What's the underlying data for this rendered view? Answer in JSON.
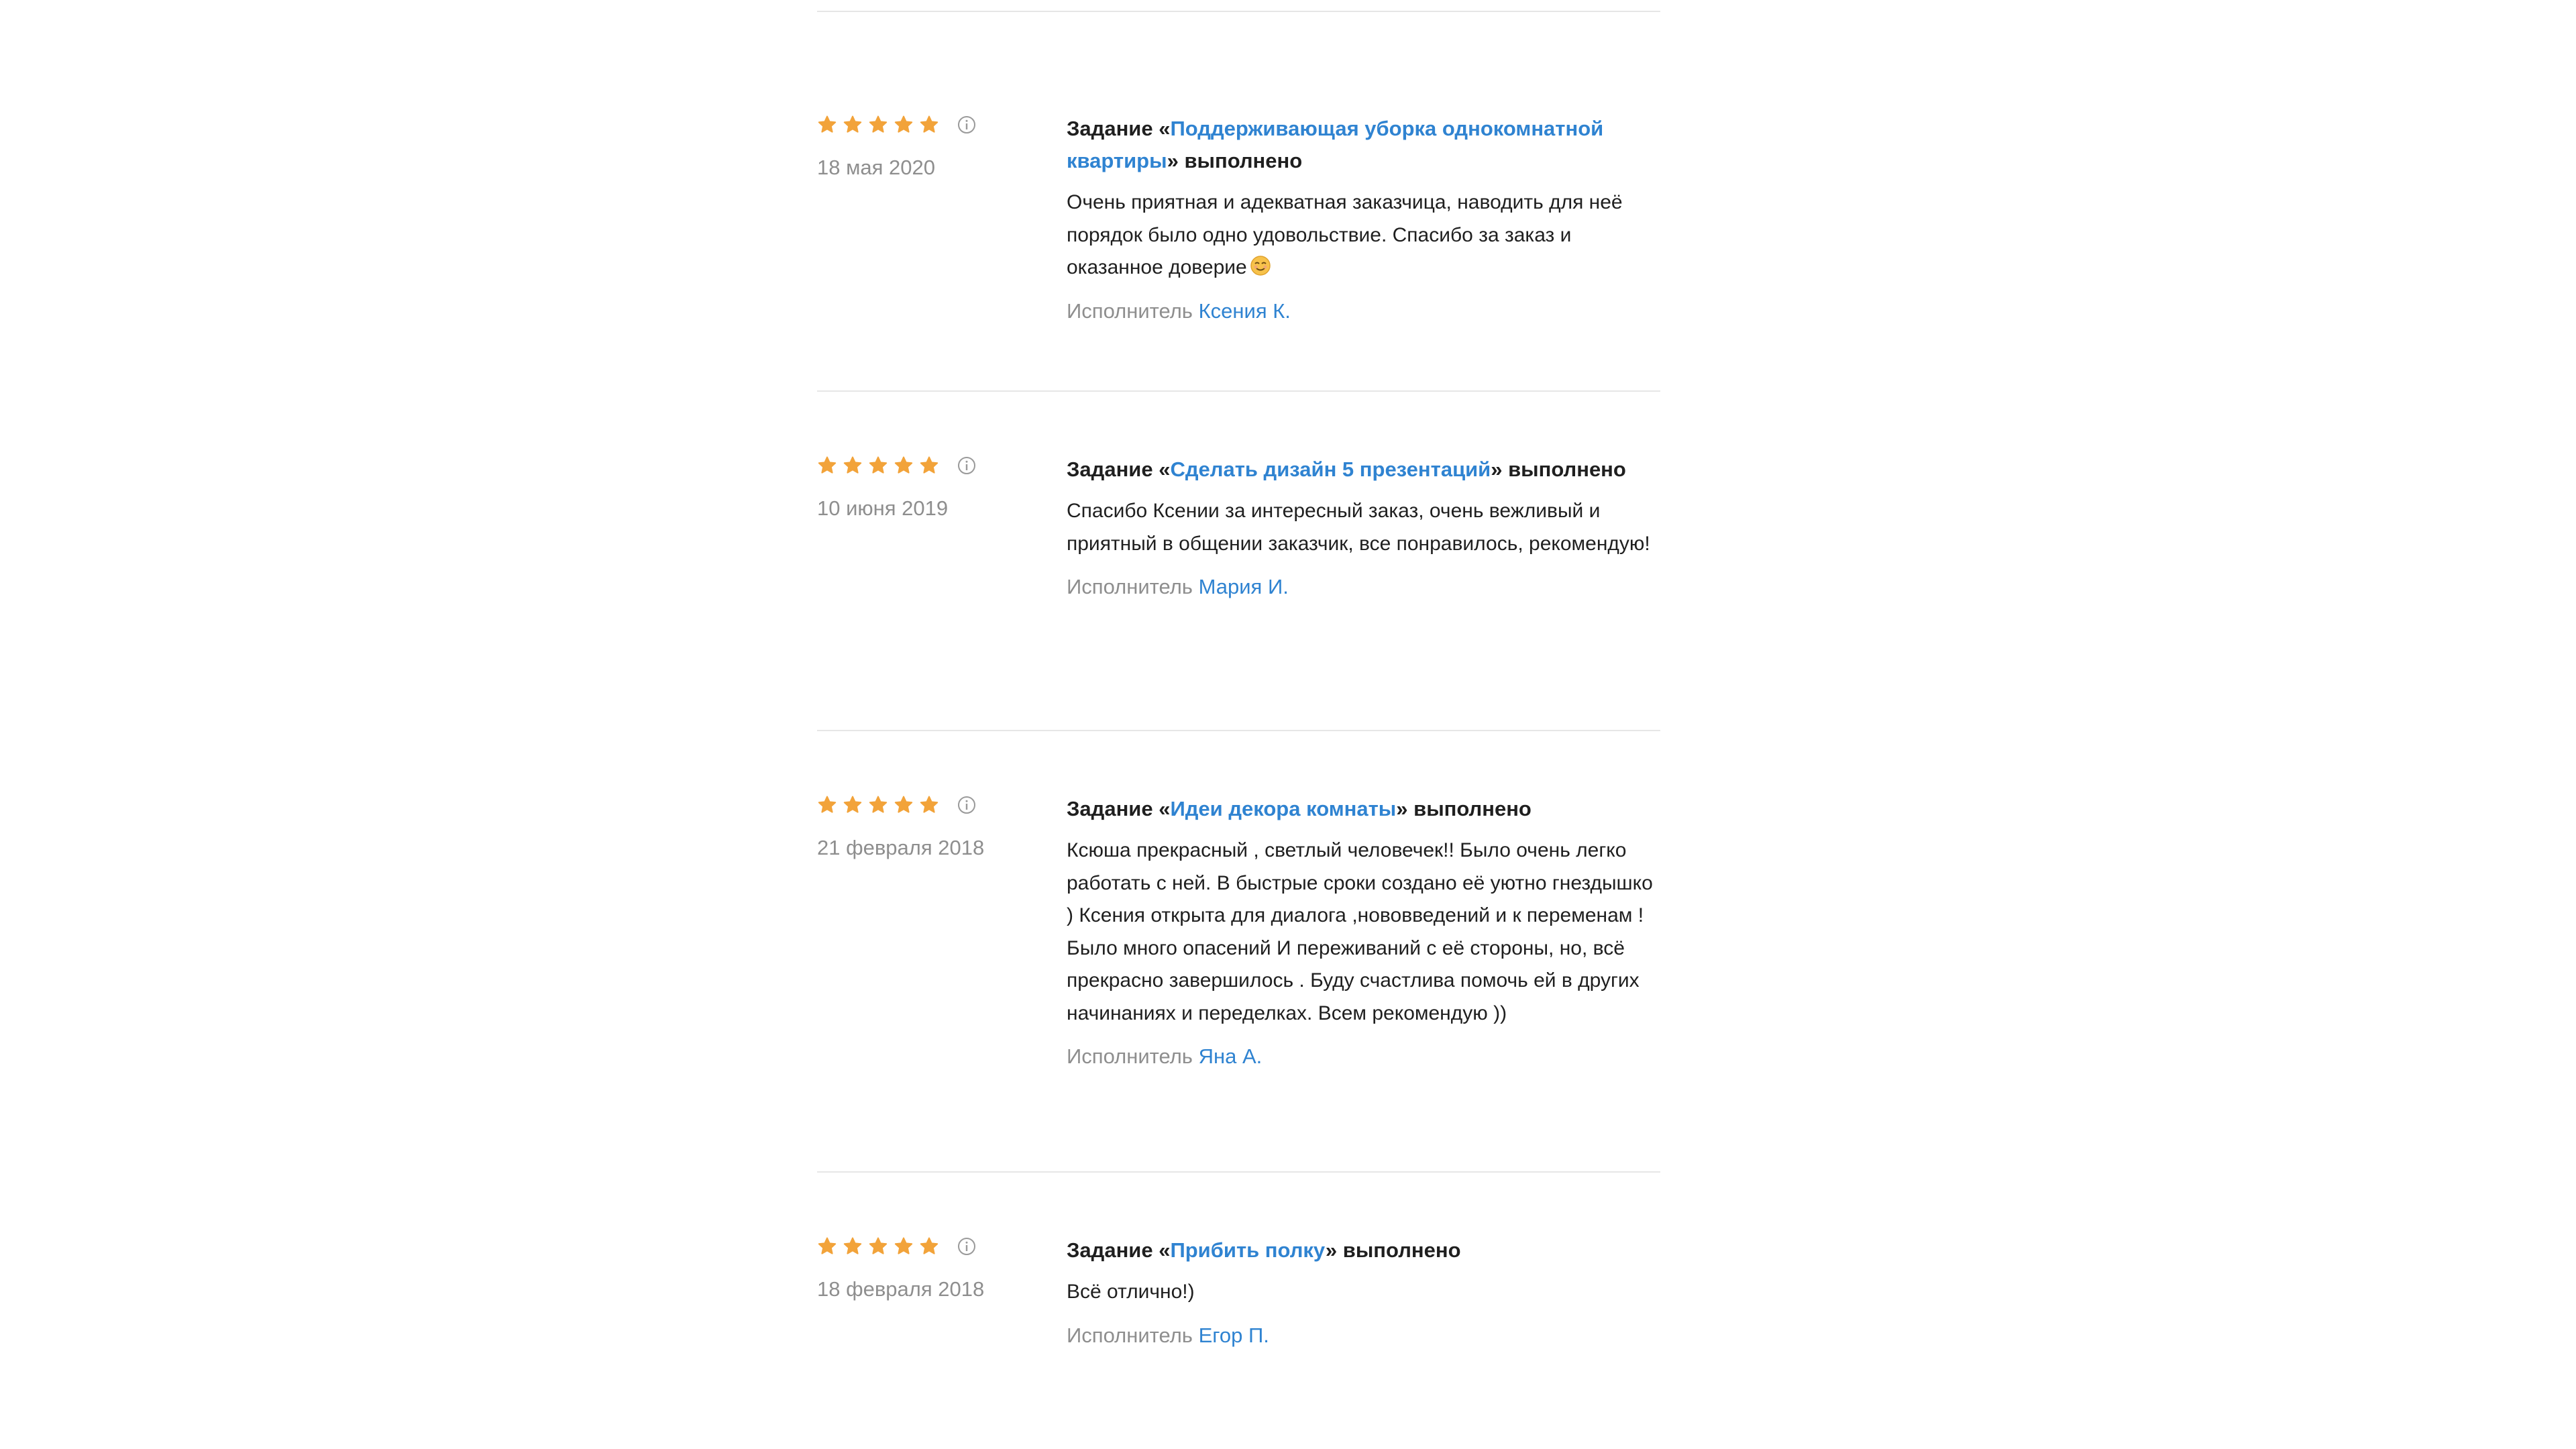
{
  "colors": {
    "star": "#f2a33a",
    "link": "#2f83d1",
    "muted": "#8e8e8e",
    "text": "#1f1f1f",
    "divider": "#e6e6e6"
  },
  "labels": {
    "task_prefix": "Задание «",
    "task_suffix": "» выполнено",
    "performer_prefix": "Исполнитель "
  },
  "reviews": [
    {
      "rating": 5,
      "date": "18 мая 2020",
      "task": "Поддерживающая уборка однокомнатной квартиры",
      "text": "Очень приятная и адекватная заказчица, наводить для неё порядок было одно удовольствие. Спасибо за заказ и оказанное доверие",
      "emoji": "smiling-face-emoji",
      "performer": "Ксения К."
    },
    {
      "rating": 5,
      "date": "10 июня 2019",
      "task": "Сделать дизайн 5 презентаций",
      "text": "Спасибо Ксении за интересный заказ, очень вежливый и приятный в общении заказчик, все понравилось, рекомендую!",
      "performer": "Мария И."
    },
    {
      "rating": 5,
      "date": "21 февраля 2018",
      "task": "Идеи декора комнаты",
      "text": "Ксюша прекрасный , светлый человечек!! Было очень легко работать с ней. В быстрые сроки создано её уютно гнездышко ) Ксения открыта для диалога ,нововведений и к переменам ! Было много опасений И переживаний с её стороны, но, всё прекрасно завершилось . Буду счастлива помочь ей в других начинаниях и переделках. Всем рекомендую ))",
      "performer": "Яна А."
    },
    {
      "rating": 5,
      "date": "18 февраля 2018",
      "task": "Прибить полку",
      "text": "Всё отлично!)",
      "performer": "Егор П."
    }
  ]
}
